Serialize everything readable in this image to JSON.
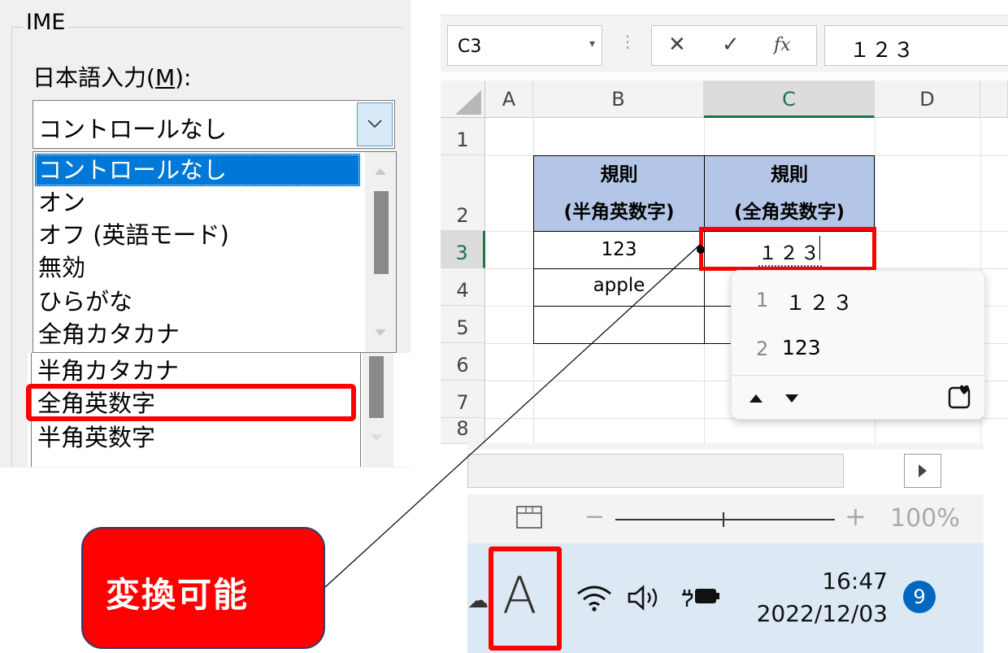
{
  "ime_panel": {
    "group_title": "IME",
    "label_prefix": "日本語入力(",
    "label_accel": "M",
    "label_suffix": "):",
    "combo_value": "コントロールなし",
    "options": [
      "コントロールなし",
      "オン",
      "オフ (英語モード)",
      "無効",
      "ひらがな",
      "全角カタカナ",
      "半角カタカナ",
      "全角英数字",
      "半角英数字"
    ],
    "highlighted_option": "全角英数字"
  },
  "excel": {
    "name_box": "C3",
    "cancel_icon": "✕",
    "enter_icon": "✓",
    "fx_label": "fx",
    "formula_value": "１２３",
    "columns": [
      "A",
      "B",
      "C",
      "D"
    ],
    "rows": [
      "1",
      "2",
      "3",
      "4",
      "5",
      "6",
      "7",
      "8"
    ],
    "table": {
      "header_b_line1": "規則",
      "header_b_line2": "(半角英数字)",
      "header_c_line1": "規則",
      "header_c_line2": "(全角英数字)",
      "b3": "123",
      "b4": "apple",
      "c3": "１２３"
    },
    "candidates": [
      {
        "num": "1",
        "text": "１２３"
      },
      {
        "num": "2",
        "text": "123"
      }
    ],
    "zoom": {
      "minus": "−",
      "plus": "+",
      "percent": "100%"
    }
  },
  "taskbar": {
    "ime_mode": "A",
    "time": "16:47",
    "date": "2022/12/03",
    "notifications": "9"
  },
  "callout": {
    "text": "変換可能"
  },
  "colors": {
    "accent_red": "#ff0000",
    "selection_blue": "#0078d7",
    "header_fill": "#b4c6e7",
    "excel_green": "#217346",
    "taskbar_bg": "#dce9f5"
  }
}
